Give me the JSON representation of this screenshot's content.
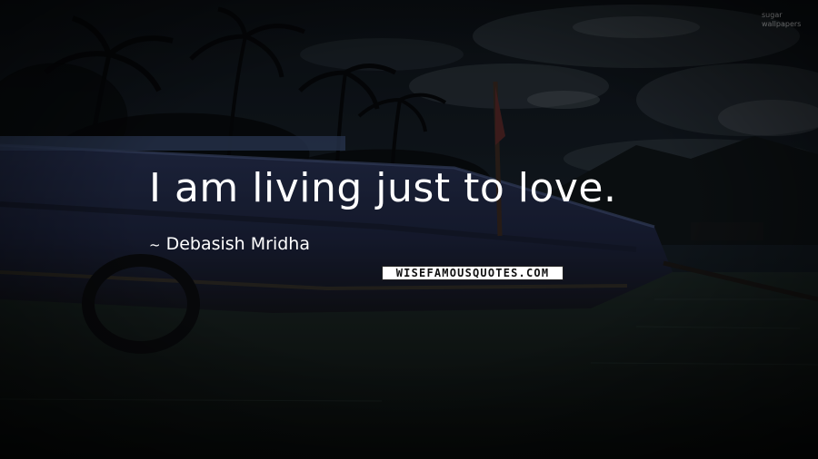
{
  "quote": {
    "text": "I am living just to love."
  },
  "author": {
    "prefix_symbol": "~",
    "name": "Debasish Mridha"
  },
  "branding": {
    "logo_text": "WISEFAMOUSQUOTES.COM",
    "corner_mark": "sugar\nwallpapers"
  },
  "colors": {
    "text": "#ffffff",
    "background": "#0d1116",
    "boat_hull": "#273152",
    "water": "#1b2423"
  }
}
